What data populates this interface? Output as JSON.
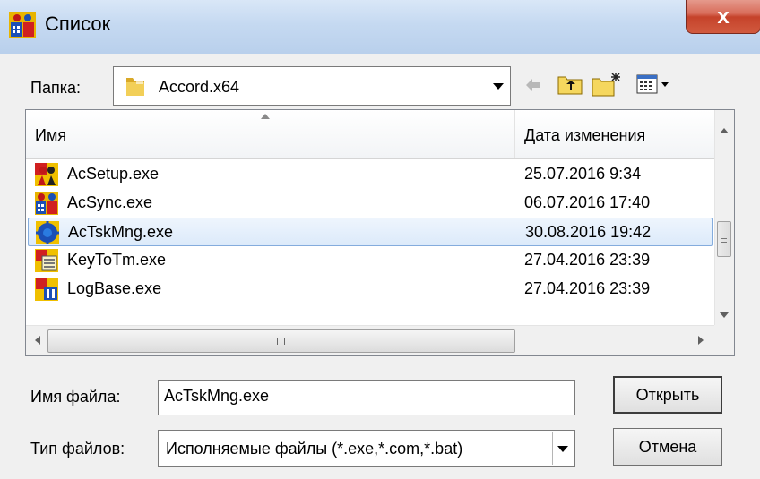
{
  "window": {
    "title": "Список",
    "close_glyph": "x"
  },
  "folder": {
    "label": "Папка:",
    "value": "Accord.x64",
    "icon": "folder-icon"
  },
  "toolbar": {
    "back_icon": "back-arrow-icon",
    "up_icon": "up-folder-icon",
    "new_folder_icon": "new-folder-icon",
    "view_menu_icon": "view-menu-icon"
  },
  "columns": {
    "name": "Имя",
    "date": "Дата изменения"
  },
  "files": [
    {
      "name": "AcSetup.exe",
      "date": "25.07.2016 9:34",
      "icon": "acsetup-app-icon",
      "selected": false
    },
    {
      "name": "AcSync.exe",
      "date": "06.07.2016 17:40",
      "icon": "acsync-app-icon",
      "selected": false
    },
    {
      "name": "AcTskMng.exe",
      "date": "30.08.2016 19:42",
      "icon": "actskmng-app-icon",
      "selected": true
    },
    {
      "name": "KeyToTm.exe",
      "date": "27.04.2016 23:39",
      "icon": "keytotm-app-icon",
      "selected": false
    },
    {
      "name": "LogBase.exe",
      "date": "27.04.2016 23:39",
      "icon": "logbase-app-icon",
      "selected": false
    }
  ],
  "filename": {
    "label": "Имя файла:",
    "value": "AcTskMng.exe"
  },
  "filetype": {
    "label": "Тип файлов:",
    "value": "Исполняемые файлы (*.exe,*.com,*.bat)"
  },
  "buttons": {
    "open": "Открыть",
    "cancel": "Отмена"
  }
}
